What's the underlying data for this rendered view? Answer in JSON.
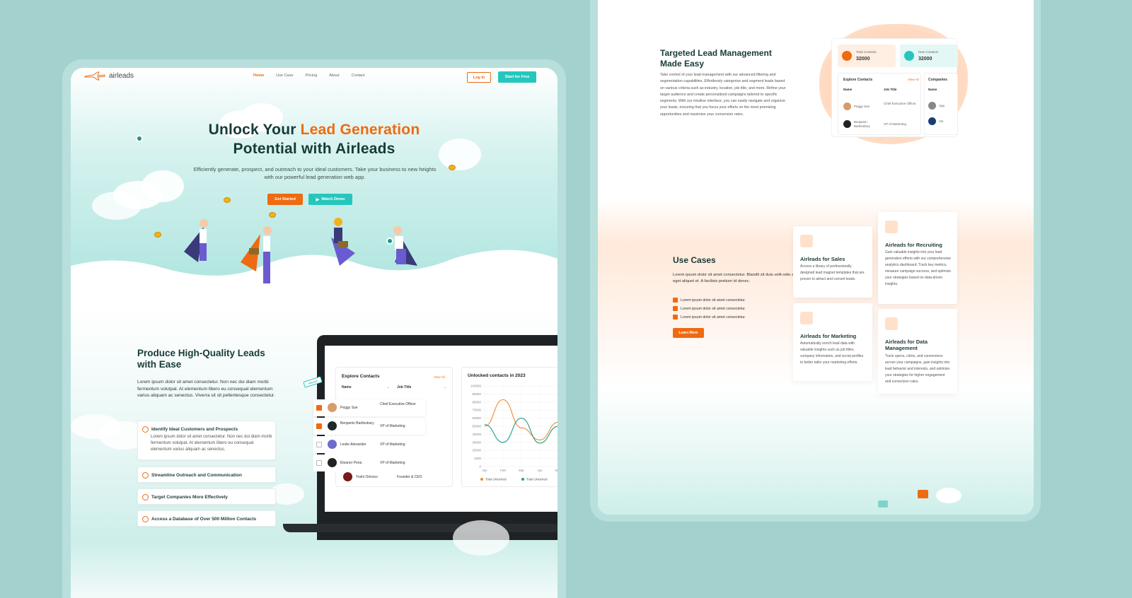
{
  "nav": {
    "brand": "airleads",
    "links": [
      "Home",
      "Use Case",
      "Pricing",
      "About",
      "Contact"
    ],
    "login": "Log In",
    "start": "Start for Free"
  },
  "hero": {
    "title_a": "Unlock Your ",
    "title_b": "Lead Generation",
    "title_c": "Potential with Airleads",
    "subtitle": "Efficiently generate, prospect, and outreach to your ideal customers. Take your business to new heights with our powerful lead generation web app.",
    "get_started": "Get Started",
    "watch_demo": "Watch Demo"
  },
  "quality": {
    "title": "Produce High-Quality Leads with Ease",
    "text": "Lorem ipsum dolor sit amet consectetur. Non nec dui diam morbi fermentum volutpat. At elementum libero eu consequat elementum varius aliquam ac senectus. Viverra sit sit pellentesque consectetur.",
    "features": [
      {
        "title": "Identify Ideal Customers and Prospects",
        "desc": "Lorem ipsum dolor sit amet consectetur. Non nec dui diam morbi fermentum volutpat. At elementum libero eu consequat elementum varius aliquam ac senectus."
      },
      {
        "title": "Streamline Outreach and Communication"
      },
      {
        "title": "Target Companies More Effectively"
      },
      {
        "title": "Access a Database of Over 500 Million Contacts"
      }
    ]
  },
  "contacts": {
    "title": "Explore Contacts",
    "view_all": "View All",
    "col_name": "Name",
    "col_job": "Job Title",
    "rows": [
      {
        "name": "Peggy Sue",
        "job": "Chief Executive Officer"
      },
      {
        "name": "Benjamin Bartlesbury",
        "job": "VP of Marketing"
      },
      {
        "name": "Leslie Alexander",
        "job": "VP of Marketing"
      },
      {
        "name": "Eleanor Pena",
        "job": "VP of Marketing"
      },
      {
        "name": "Yoshi Orinoco",
        "job": "Founder & CEO"
      }
    ],
    "chip": "Selected"
  },
  "chart_data": {
    "type": "line",
    "title": "Unlocked contacts in 2023",
    "x": [
      "Jan",
      "Feb",
      "Mar",
      "Apr",
      "May"
    ],
    "y_ticks": [
      "100000",
      "90000",
      "80000",
      "70000",
      "60000",
      "50000",
      "40000",
      "30000",
      "20000",
      "1000",
      "0"
    ],
    "ylim": [
      0,
      100000
    ],
    "series": [
      {
        "name": "Total Unlocked",
        "color": "#ef8a2e",
        "values": [
          50000,
          83000,
          48000,
          33000,
          55000
        ]
      },
      {
        "name": "Total Unlocked",
        "color": "#1f9d8e",
        "values": [
          52000,
          30000,
          60000,
          29000,
          50000
        ]
      }
    ]
  },
  "targeted": {
    "title": "Targeted Lead Management Made Easy",
    "text": "Take control of your lead management with our advanced filtering and segmentation capabilities. Effortlessly categorize and segment leads based on various criteria such as industry, location, job title, and more. Refine your target audience and create personalized campaigns tailored to specific segments. With our intuitive interface, you can easily navigate and organize your leads, ensuring that you focus your efforts on the most promising opportunities and maximize your conversion rates.",
    "total_label": "Total Contacts",
    "total_value": "32000",
    "new_label": "New Contacts",
    "new_value": "32000",
    "explore": "Explore Contacts",
    "view_all": "View All",
    "col_name": "Name",
    "col_job": "Job Title",
    "companies": "Companies",
    "rows": [
      {
        "name": "Peggy Sue",
        "job": "Chief Executive Officer"
      },
      {
        "name": "Benjamin Bartlesbury",
        "job": "VP of Marketing"
      }
    ],
    "company_rows": [
      "App",
      "Vol"
    ]
  },
  "usecases": {
    "title": "Use Cases",
    "text": "Lorem ipsum dolor sit amet consectetur. Blandit sit duis velit odio a eget aliquet et. A facilisis pretium id donec.",
    "checks": [
      "Lorem ipsum dolor sit amet consectetur.",
      "Lorem ipsum dolor sit amet consectetur.",
      "Lorem ipsum dolor sit amet consectetur."
    ],
    "learn_more": "Learn More",
    "cards": [
      {
        "title": "Airleads for Sales",
        "desc": "Access a library of professionally designed lead magnet templates that are proven to attract and convert leads."
      },
      {
        "title": "Airleads for Recruiting",
        "desc": "Gain valuable insights into your lead generation efforts with our comprehensive analytics dashboard. Track key metrics, measure campaign success, and optimize your strategies based on data-driven insights."
      },
      {
        "title": "Airleads for Marketing",
        "desc": "Automatically enrich lead data with valuable insights such as job titles, company information, and social profiles to better tailor your marketing efforts."
      },
      {
        "title": "Airleads for Data Management",
        "desc": "Track opens, clicks, and conversions across your campaigns, gain insights into lead behavior and interests, and optimize your strategies for higher engagement and conversion rates."
      }
    ]
  }
}
